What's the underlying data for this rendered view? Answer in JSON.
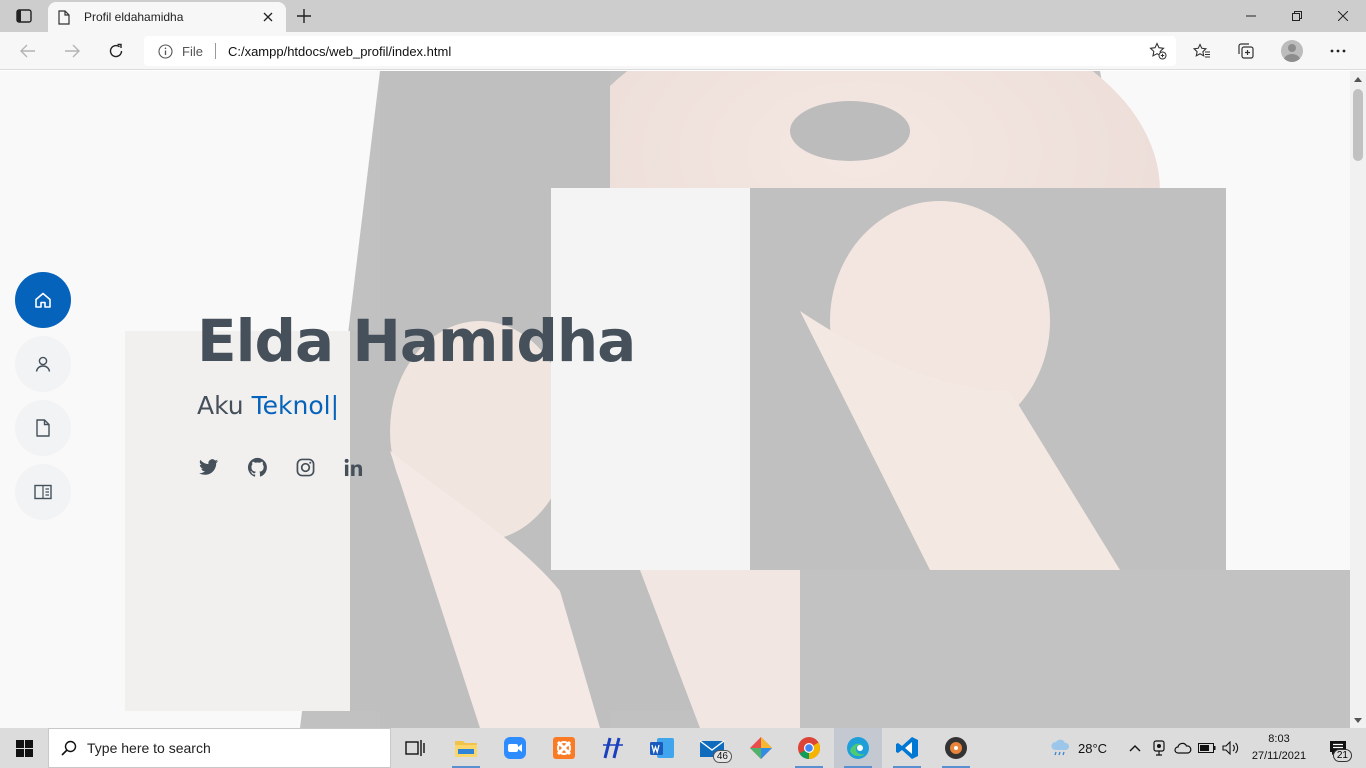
{
  "browser": {
    "tab_title": "Profil eldahamidha",
    "file_label": "File",
    "url": "C:/xampp/htdocs/web_profil/index.html"
  },
  "page": {
    "side_nav": [
      {
        "icon": "home-icon",
        "active": true
      },
      {
        "icon": "user-icon",
        "active": false
      },
      {
        "icon": "file-icon",
        "active": false
      },
      {
        "icon": "book-icon",
        "active": false
      }
    ],
    "hero": {
      "name": "Elda Hamidha",
      "prefix": "Aku",
      "typed": "Teknol",
      "cursor": "|"
    },
    "socials": [
      "twitter-icon",
      "github-icon",
      "instagram-icon",
      "linkedin-icon"
    ],
    "accent_color": "#0563bb",
    "text_color": "#45505b"
  },
  "taskbar": {
    "search_placeholder": "Type here to search",
    "mail_badge": "46",
    "temperature": "28°C",
    "time": "8:03",
    "date": "27/11/2021",
    "notifications": "21"
  }
}
